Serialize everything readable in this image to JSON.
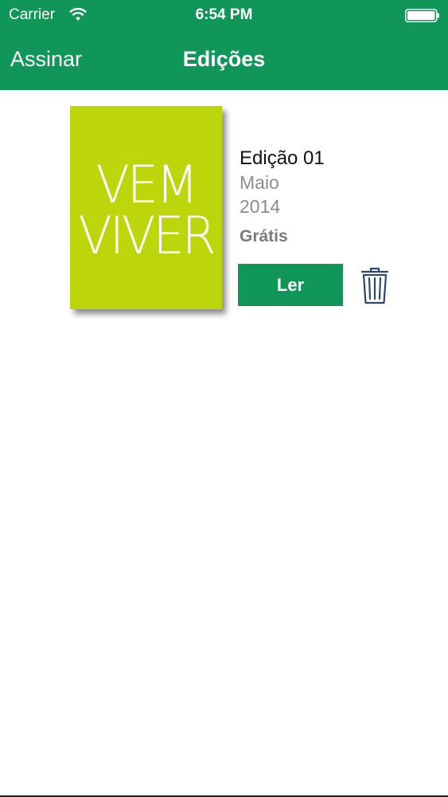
{
  "status_bar": {
    "carrier": "Carrier",
    "time": "6:54 PM",
    "wifi_icon": "wifi-icon",
    "battery_icon": "battery-icon"
  },
  "nav": {
    "left_button": "Assinar",
    "title": "Edições"
  },
  "issues": [
    {
      "cover": {
        "line1": "VEM",
        "line2": "VIVER",
        "color": "#bdd50b"
      },
      "name": "Edição 01",
      "month": "Maio",
      "year": "2014",
      "price": "Grátis",
      "read_label": "Ler",
      "delete_icon": "trash-icon"
    }
  ],
  "colors": {
    "brand_green": "#109659",
    "cover_lime": "#bdd50b",
    "secondary_text": "#8c8c8c",
    "icon_blue": "#2b4a66"
  }
}
